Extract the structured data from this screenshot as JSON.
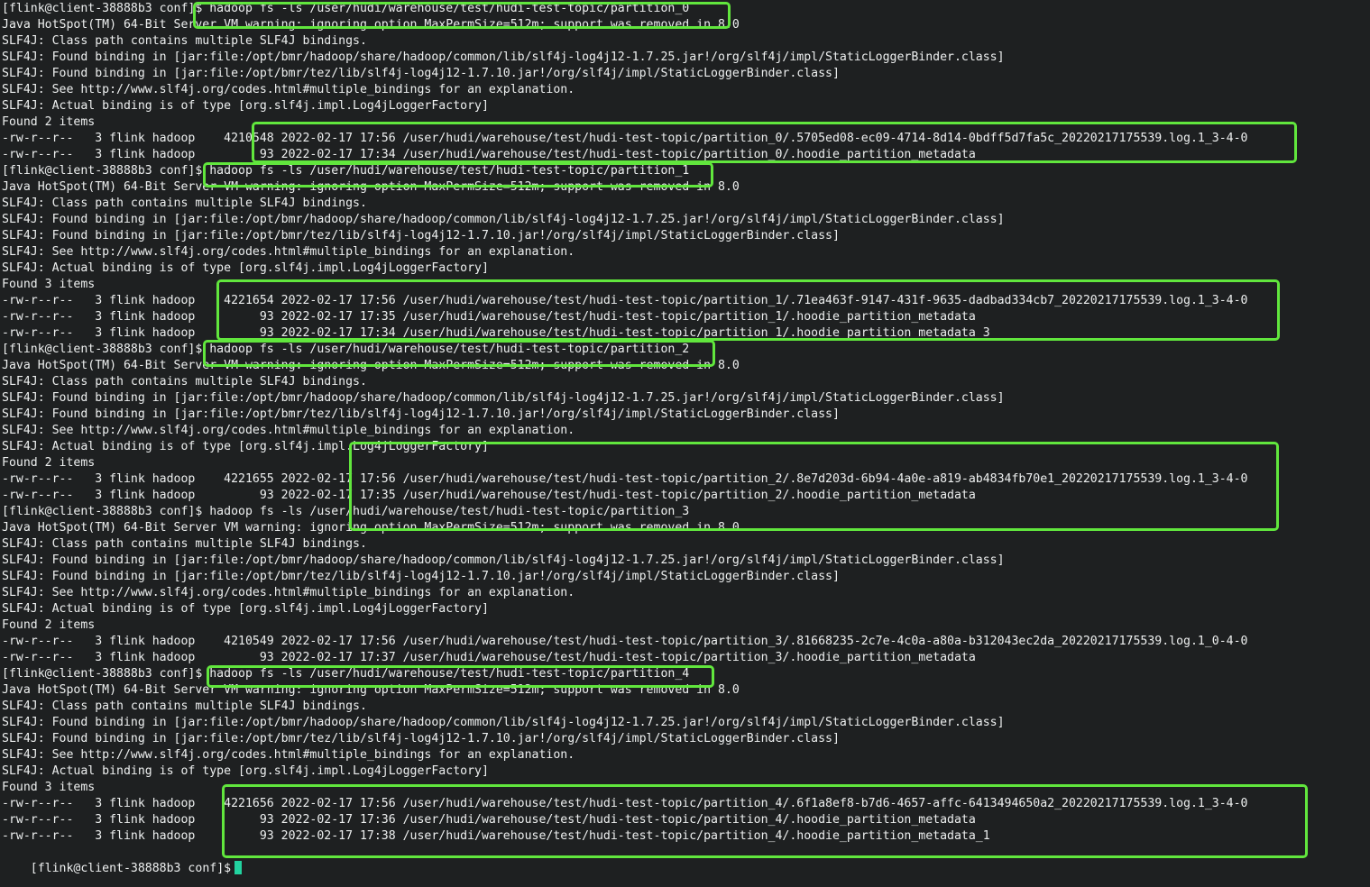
{
  "terminal": {
    "lines": [
      "[flink@client-38888b3 conf]$ hadoop fs -ls /user/hudi/warehouse/test/hudi-test-topic/partition_0",
      "Java HotSpot(TM) 64-Bit Server VM warning: ignoring option MaxPermSize=512m; support was removed in 8.0",
      "SLF4J: Class path contains multiple SLF4J bindings.",
      "SLF4J: Found binding in [jar:file:/opt/bmr/hadoop/share/hadoop/common/lib/slf4j-log4j12-1.7.25.jar!/org/slf4j/impl/StaticLoggerBinder.class]",
      "SLF4J: Found binding in [jar:file:/opt/bmr/tez/lib/slf4j-log4j12-1.7.10.jar!/org/slf4j/impl/StaticLoggerBinder.class]",
      "SLF4J: See http://www.slf4j.org/codes.html#multiple_bindings for an explanation.",
      "SLF4J: Actual binding is of type [org.slf4j.impl.Log4jLoggerFactory]",
      "Found 2 items",
      "-rw-r--r--   3 flink hadoop    4210548 2022-02-17 17:56 /user/hudi/warehouse/test/hudi-test-topic/partition_0/.5705ed08-ec09-4714-8d14-0bdff5d7fa5c_20220217175539.log.1_3-4-0",
      "-rw-r--r--   3 flink hadoop         93 2022-02-17 17:34 /user/hudi/warehouse/test/hudi-test-topic/partition_0/.hoodie_partition_metadata",
      "[flink@client-38888b3 conf]$ hadoop fs -ls /user/hudi/warehouse/test/hudi-test-topic/partition_1",
      "Java HotSpot(TM) 64-Bit Server VM warning: ignoring option MaxPermSize=512m; support was removed in 8.0",
      "SLF4J: Class path contains multiple SLF4J bindings.",
      "SLF4J: Found binding in [jar:file:/opt/bmr/hadoop/share/hadoop/common/lib/slf4j-log4j12-1.7.25.jar!/org/slf4j/impl/StaticLoggerBinder.class]",
      "SLF4J: Found binding in [jar:file:/opt/bmr/tez/lib/slf4j-log4j12-1.7.10.jar!/org/slf4j/impl/StaticLoggerBinder.class]",
      "SLF4J: See http://www.slf4j.org/codes.html#multiple_bindings for an explanation.",
      "SLF4J: Actual binding is of type [org.slf4j.impl.Log4jLoggerFactory]",
      "Found 3 items",
      "-rw-r--r--   3 flink hadoop    4221654 2022-02-17 17:56 /user/hudi/warehouse/test/hudi-test-topic/partition_1/.71ea463f-9147-431f-9635-dadbad334cb7_20220217175539.log.1_3-4-0",
      "-rw-r--r--   3 flink hadoop         93 2022-02-17 17:35 /user/hudi/warehouse/test/hudi-test-topic/partition_1/.hoodie_partition_metadata",
      "-rw-r--r--   3 flink hadoop         93 2022-02-17 17:34 /user/hudi/warehouse/test/hudi-test-topic/partition_1/.hoodie_partition_metadata_3",
      "[flink@client-38888b3 conf]$ hadoop fs -ls /user/hudi/warehouse/test/hudi-test-topic/partition_2",
      "Java HotSpot(TM) 64-Bit Server VM warning: ignoring option MaxPermSize=512m; support was removed in 8.0",
      "SLF4J: Class path contains multiple SLF4J bindings.",
      "SLF4J: Found binding in [jar:file:/opt/bmr/hadoop/share/hadoop/common/lib/slf4j-log4j12-1.7.25.jar!/org/slf4j/impl/StaticLoggerBinder.class]",
      "SLF4J: Found binding in [jar:file:/opt/bmr/tez/lib/slf4j-log4j12-1.7.10.jar!/org/slf4j/impl/StaticLoggerBinder.class]",
      "SLF4J: See http://www.slf4j.org/codes.html#multiple_bindings for an explanation.",
      "SLF4J: Actual binding is of type [org.slf4j.impl.Log4jLoggerFactory]",
      "Found 2 items",
      "-rw-r--r--   3 flink hadoop    4221655 2022-02-17 17:56 /user/hudi/warehouse/test/hudi-test-topic/partition_2/.8e7d203d-6b94-4a0e-a819-ab4834fb70e1_20220217175539.log.1_3-4-0",
      "-rw-r--r--   3 flink hadoop         93 2022-02-17 17:35 /user/hudi/warehouse/test/hudi-test-topic/partition_2/.hoodie_partition_metadata",
      "[flink@client-38888b3 conf]$ hadoop fs -ls /user/hudi/warehouse/test/hudi-test-topic/partition_3",
      "Java HotSpot(TM) 64-Bit Server VM warning: ignoring option MaxPermSize=512m; support was removed in 8.0",
      "SLF4J: Class path contains multiple SLF4J bindings.",
      "SLF4J: Found binding in [jar:file:/opt/bmr/hadoop/share/hadoop/common/lib/slf4j-log4j12-1.7.25.jar!/org/slf4j/impl/StaticLoggerBinder.class]",
      "SLF4J: Found binding in [jar:file:/opt/bmr/tez/lib/slf4j-log4j12-1.7.10.jar!/org/slf4j/impl/StaticLoggerBinder.class]",
      "SLF4J: See http://www.slf4j.org/codes.html#multiple_bindings for an explanation.",
      "SLF4J: Actual binding is of type [org.slf4j.impl.Log4jLoggerFactory]",
      "Found 2 items",
      "-rw-r--r--   3 flink hadoop    4210549 2022-02-17 17:56 /user/hudi/warehouse/test/hudi-test-topic/partition_3/.81668235-2c7e-4c0a-a80a-b312043ec2da_20220217175539.log.1_0-4-0",
      "-rw-r--r--   3 flink hadoop         93 2022-02-17 17:37 /user/hudi/warehouse/test/hudi-test-topic/partition_3/.hoodie_partition_metadata",
      "[flink@client-38888b3 conf]$ hadoop fs -ls /user/hudi/warehouse/test/hudi-test-topic/partition_4",
      "Java HotSpot(TM) 64-Bit Server VM warning: ignoring option MaxPermSize=512m; support was removed in 8.0",
      "SLF4J: Class path contains multiple SLF4J bindings.",
      "SLF4J: Found binding in [jar:file:/opt/bmr/hadoop/share/hadoop/common/lib/slf4j-log4j12-1.7.25.jar!/org/slf4j/impl/StaticLoggerBinder.class]",
      "SLF4J: Found binding in [jar:file:/opt/bmr/tez/lib/slf4j-log4j12-1.7.10.jar!/org/slf4j/impl/StaticLoggerBinder.class]",
      "SLF4J: See http://www.slf4j.org/codes.html#multiple_bindings for an explanation.",
      "SLF4J: Actual binding is of type [org.slf4j.impl.Log4jLoggerFactory]",
      "Found 3 items",
      "-rw-r--r--   3 flink hadoop    4221656 2022-02-17 17:56 /user/hudi/warehouse/test/hudi-test-topic/partition_4/.6f1a8ef8-b7d6-4657-affc-6413494650a2_20220217175539.log.1_3-4-0",
      "-rw-r--r--   3 flink hadoop         93 2022-02-17 17:36 /user/hudi/warehouse/test/hudi-test-topic/partition_4/.hoodie_partition_metadata",
      "-rw-r--r--   3 flink hadoop         93 2022-02-17 17:38 /user/hudi/warehouse/test/hudi-test-topic/partition_4/.hoodie_partition_metadata_1"
    ],
    "prompt": "[flink@client-38888b3 conf]$",
    "cursor_color": "#22d3a0",
    "background_color": "#1e2021",
    "text_color": "#eef0f0"
  },
  "annotations": {
    "color": "#61e63d"
  }
}
